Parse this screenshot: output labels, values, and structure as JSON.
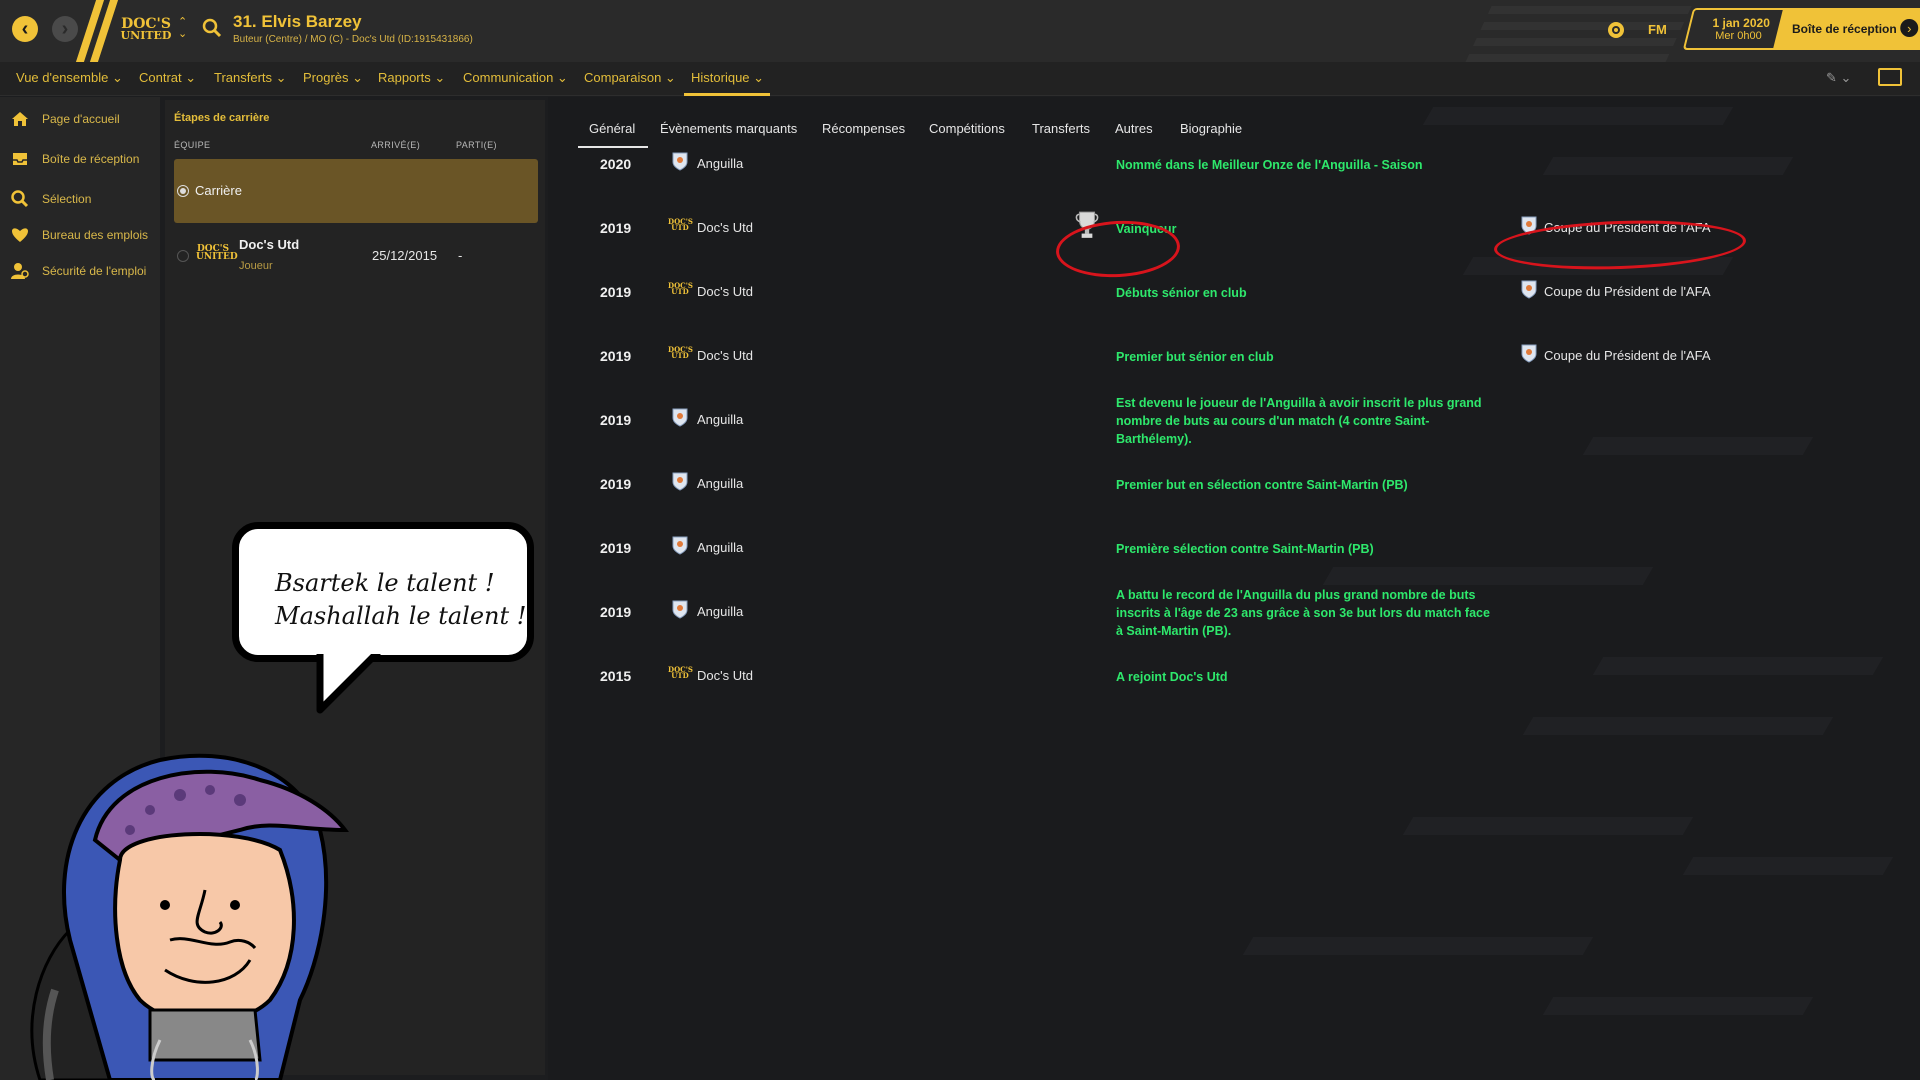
{
  "header": {
    "player_name": "31. Elvis Barzey",
    "player_sub": "Buteur (Centre) / MO (C) - Doc's Utd (ID:1915431866)",
    "club_logo_top": "DOC'S",
    "club_logo_bottom": "UNITED",
    "fm_label": "FM",
    "date": "1 jan 2020",
    "time": "Mer 0h00",
    "inbox_button": "Boîte de réception"
  },
  "menu": [
    {
      "label": "Vue d'ensemble ⌄"
    },
    {
      "label": "Contrat ⌄"
    },
    {
      "label": "Transferts ⌄"
    },
    {
      "label": "Progrès ⌄"
    },
    {
      "label": "Rapports ⌄"
    },
    {
      "label": "Communication ⌄"
    },
    {
      "label": "Comparaison ⌄"
    },
    {
      "label": "Historique ⌄"
    }
  ],
  "sidebar": [
    {
      "label": "Page d'accueil",
      "icon": "home-icon"
    },
    {
      "label": "Boîte de réception",
      "icon": "inbox-icon"
    },
    {
      "label": "Sélection",
      "icon": "search-icon"
    },
    {
      "label": "Bureau des emplois",
      "icon": "jobs-icon"
    },
    {
      "label": "Sécurité de l'emploi",
      "icon": "security-icon"
    }
  ],
  "career": {
    "title": "Étapes de carrière",
    "columns": [
      "ÉQUIPE",
      "ARRIVÉ(E)",
      "PARTI(E)"
    ],
    "selected": "Carrière",
    "rows": [
      {
        "club": "Doc's Utd",
        "role": "Joueur",
        "arrived": "25/12/2015",
        "left": "-"
      }
    ]
  },
  "tabs": [
    "Général",
    "Évènements marquants",
    "Récompenses",
    "Compétitions",
    "Transferts",
    "Autres",
    "Biographie"
  ],
  "history": [
    {
      "year": "2020",
      "team": "Anguilla",
      "team_logo": "shield",
      "event": "Nommé dans le Meilleur Onze de l'Anguilla - Saison",
      "competition": ""
    },
    {
      "year": "2019",
      "team": "Doc's Utd",
      "team_logo": "docs",
      "event": "Vainqueur",
      "competition": "Coupe du Président de l'AFA",
      "trophy": true
    },
    {
      "year": "2019",
      "team": "Doc's Utd",
      "team_logo": "docs",
      "event": "Débuts sénior en club",
      "competition": "Coupe du Président de l'AFA"
    },
    {
      "year": "2019",
      "team": "Doc's Utd",
      "team_logo": "docs",
      "event": "Premier but sénior en club",
      "competition": "Coupe du Président de l'AFA"
    },
    {
      "year": "2019",
      "team": "Anguilla",
      "team_logo": "shield",
      "event": "Est devenu le joueur de l'Anguilla à avoir inscrit le plus grand nombre de buts au cours d'un match (4 contre Saint-Barthélemy).",
      "competition": ""
    },
    {
      "year": "2019",
      "team": "Anguilla",
      "team_logo": "shield",
      "event": "Premier but en sélection contre Saint-Martin (PB)",
      "competition": ""
    },
    {
      "year": "2019",
      "team": "Anguilla",
      "team_logo": "shield",
      "event": "Première sélection contre Saint-Martin (PB)",
      "competition": ""
    },
    {
      "year": "2019",
      "team": "Anguilla",
      "team_logo": "shield",
      "event": "A battu le record de l'Anguilla du plus grand nombre de buts inscrits à l'âge de 23 ans grâce à son 3e but lors du match face à Saint-Martin (PB).",
      "competition": ""
    },
    {
      "year": "2015",
      "team": "Doc's Utd",
      "team_logo": "docs",
      "event": "A rejoint Doc's Utd",
      "competition": ""
    }
  ],
  "bubble": {
    "line1": "Bsartek le talent !",
    "line2": "Mashallah le talent !"
  },
  "colors": {
    "accent": "#f0c238",
    "event_green": "#2ee86c",
    "annotation_red": "#d8141c"
  }
}
